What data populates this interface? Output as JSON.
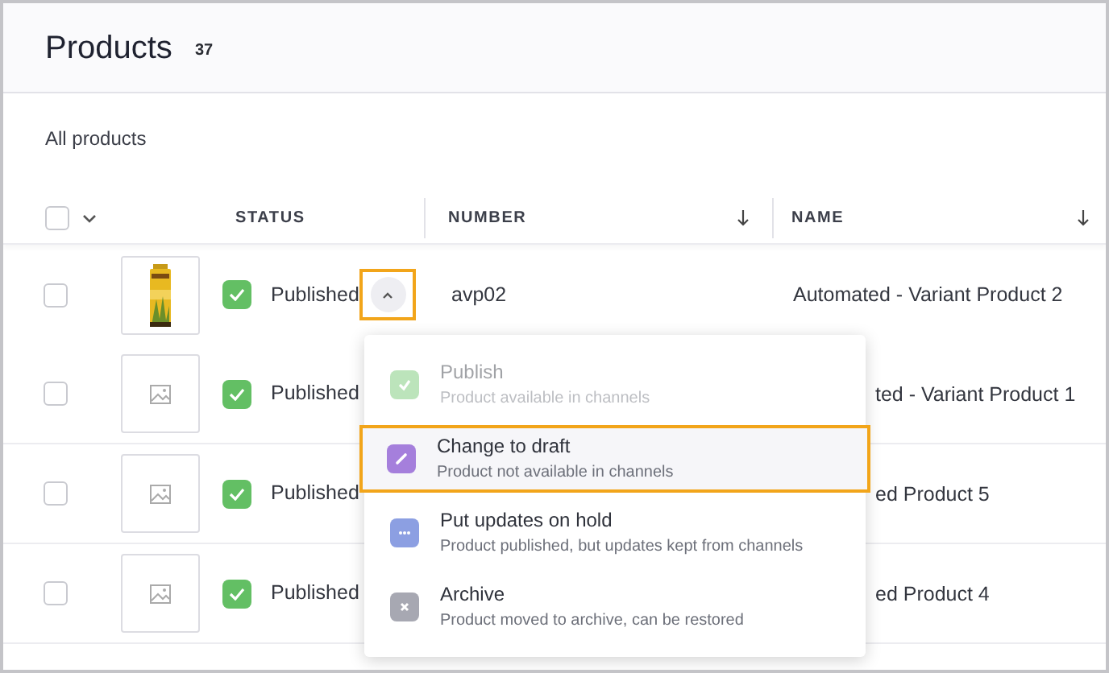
{
  "header": {
    "title": "Products",
    "count": "37"
  },
  "view": {
    "label": "All products"
  },
  "table": {
    "select_all": {
      "checked": false
    },
    "columns": [
      {
        "label": "STATUS",
        "sorted": false
      },
      {
        "label": "NUMBER",
        "sorted": true
      },
      {
        "label": "NAME",
        "sorted": true
      }
    ],
    "rows": [
      {
        "checked": false,
        "status": "Published",
        "menu_open": true,
        "number": "avp02",
        "name": "Automated - Variant Product 2"
      },
      {
        "checked": false,
        "thumbnail": {
          "kind": "placeholder"
        },
        "status": "Published",
        "menu_open": false,
        "name": "ted - Variant Product 1"
      },
      {
        "checked": false,
        "thumbnail": {
          "kind": "placeholder"
        },
        "status": "Published",
        "menu_open": false,
        "name": "ed Product 5"
      },
      {
        "checked": false,
        "thumbnail": {
          "kind": "placeholder"
        },
        "status": "Published",
        "menu_open": false,
        "name": "ed Product 4"
      }
    ]
  },
  "status_menu": {
    "items": [
      {
        "kind": "publish",
        "title": "Publish",
        "description": "Product available in channels",
        "disabled": true,
        "selected": false
      },
      {
        "kind": "draft",
        "title": "Change to draft",
        "description": "Product not available in channels",
        "disabled": false,
        "selected": true
      },
      {
        "kind": "hold",
        "title": "Put updates on hold",
        "description": "Product published, but updates kept from channels",
        "disabled": false,
        "selected": false
      },
      {
        "kind": "archive",
        "title": "Archive",
        "description": "Product moved to archive, can be restored",
        "disabled": false,
        "selected": false
      }
    ]
  }
}
